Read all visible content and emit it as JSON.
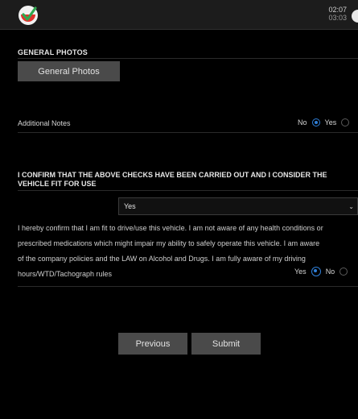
{
  "header": {
    "time": "02:07",
    "timer": "03:03"
  },
  "general_photos": {
    "title": "GENERAL PHOTOS",
    "button_label": "General Photos"
  },
  "additional_notes": {
    "label": "Additional Notes",
    "no_label": "No",
    "yes_label": "Yes",
    "selected": "No"
  },
  "confirm": {
    "title": "I CONFIRM THAT THE ABOVE CHECKS HAVE BEEN CARRIED OUT AND I CONSIDER THE VEHICLE FIT FOR USE",
    "select_value": "Yes"
  },
  "declaration": {
    "line1": "I hereby confirm that I am fit to drive/use this vehicle. I am not aware of any health conditions or",
    "line2": "prescribed medications which might impair my ability to safely operate this vehicle. I am aware",
    "line3": "of the company policies and the LAW on Alcohol and Drugs. I am fully aware of my driving",
    "line4": "hours/WTD/Tachograph rules",
    "yes_label": "Yes",
    "no_label": "No",
    "selected": "Yes"
  },
  "nav": {
    "previous_label": "Previous",
    "submit_label": "Submit"
  },
  "colors": {
    "accent": "#2f7fd8",
    "button_bg": "#4a4a4a",
    "background": "#000000"
  }
}
